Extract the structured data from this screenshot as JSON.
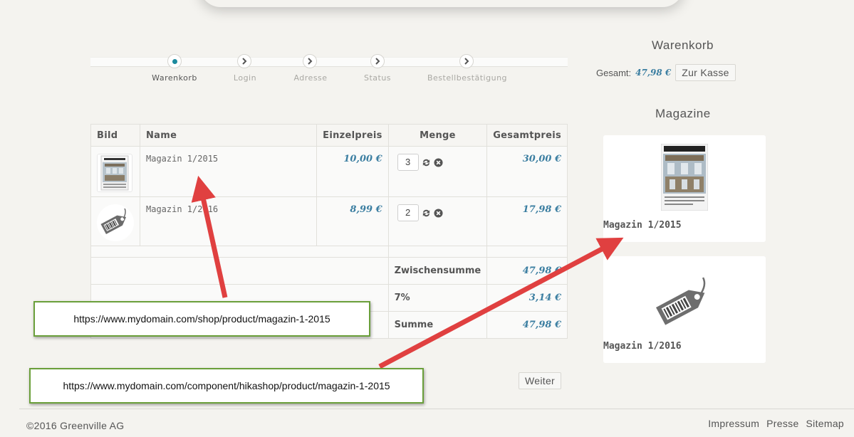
{
  "steps": [
    {
      "label": "Warenkorb",
      "active": true
    },
    {
      "label": "Login",
      "active": false
    },
    {
      "label": "Adresse",
      "active": false
    },
    {
      "label": "Status",
      "active": false
    },
    {
      "label": "Bestellbestätigung",
      "active": false
    }
  ],
  "table": {
    "headers": {
      "image": "Bild",
      "name": "Name",
      "unit_price": "Einzelpreis",
      "quantity": "Menge",
      "total": "Gesamtpreis"
    },
    "items": [
      {
        "name": "Magazin 1/2015",
        "unit_price": "10,00 €",
        "quantity": "3",
        "total": "30,00 €",
        "image_icon": "magazine-cover-icon"
      },
      {
        "name": "Magazin 1/2016",
        "unit_price": "8,99 €",
        "quantity": "2",
        "total": "17,98 €",
        "image_icon": "price-tag-icon"
      }
    ],
    "subtotal_label": "Zwischensumme",
    "subtotal_value": "47,98 €",
    "tax_label": "7%",
    "tax_value": "3,14 €",
    "sum_label": "Summe",
    "sum_value": "47,98 €"
  },
  "next_button": "Weiter",
  "sidebar": {
    "cart_title": "Warenkorb",
    "total_label": "Gesamt:",
    "total_value": "47,98 €",
    "checkout_button": "Zur Kasse",
    "magazines_title": "Magazine",
    "products": [
      {
        "name": "Magazin 1/2015"
      },
      {
        "name": "Magazin 1/2016"
      }
    ]
  },
  "annotations": {
    "url_1": "https://www.mydomain.com/shop/product/magazin-1-2015",
    "url_2": "https://www.mydomain.com/component/hikashop/product/magazin-1-2015"
  },
  "footer": {
    "copyright": "©2016 Greenville AG",
    "links": [
      "Impressum",
      "Presse",
      "Sitemap"
    ]
  },
  "colors": {
    "accent": "#1c8a9e",
    "price": "#3b7ea1",
    "annotation_border": "#6a9f3a",
    "arrow": "#e04040"
  }
}
